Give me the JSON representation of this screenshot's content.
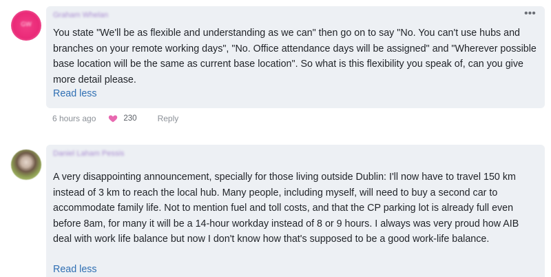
{
  "comments": [
    {
      "author": "Graham Whelan",
      "avatar_initials": "GW",
      "text": "You state \"We'll be as flexible and understanding as we can\" then go on to say \"No. You can't use hubs and branches on your remote working days\", \"No. Office attendance days will be assigned\" and \"Wherever possible base location will be the same as current base location\". So what is this flexibility you speak of, can you give more detail please.",
      "read_less": "Read less",
      "more_icon": "more-horizontal-icon",
      "timestamp": "6 hours ago",
      "likes": "230",
      "reply_label": "Reply"
    },
    {
      "author": "Daniel Laham Pessis",
      "text": "A very disappointing announcement, specially for those living outside Dublin: I'll now have to travel 150 km instead of 3 km to reach the local hub. Many people, including myself, will need to buy a second car to accommodate family life. Not to mention fuel and toll costs, and that the CP parking lot is already full even before 8am, for many it will be a 14-hour workday instead of 8 or 9 hours. I always was very proud how AIB deal with work life balance but now I don't know how that's supposed to be a good work-life balance.",
      "read_less": "Read less"
    }
  ],
  "colors": {
    "bubble_bg": "#edf0f4",
    "link": "#2f6fb3",
    "heart": "#e869b0",
    "avatar_pink": "#ea2a78"
  }
}
